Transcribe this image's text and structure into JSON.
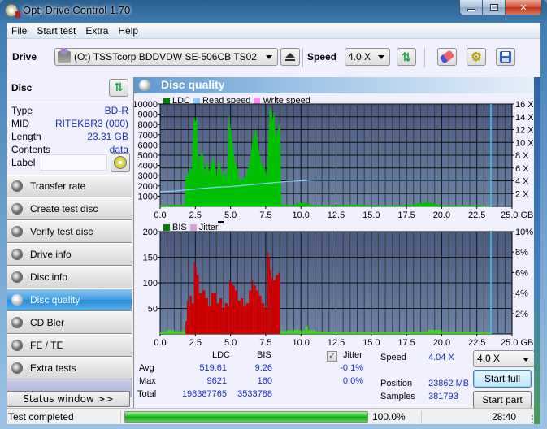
{
  "window": {
    "title": "Opti Drive Control 1.70",
    "controls": {
      "minimize": "minimize",
      "maximize": "maximize",
      "close": "close"
    }
  },
  "menu": [
    "File",
    "Start test",
    "Extra",
    "Help"
  ],
  "toolbar": {
    "drive_label": "Drive",
    "drive_value": "(O:)  TSSTcorp BDDVDW SE-506CB TS02",
    "speed_label": "Speed",
    "speed_value": "4.0 X",
    "icons": [
      "eject-icon",
      "refresh-icon",
      "erase-icon",
      "settings-icon",
      "save-icon"
    ]
  },
  "disc": {
    "title": "Disc",
    "fields": [
      {
        "label": "Type",
        "value": "BD-R"
      },
      {
        "label": "MID",
        "value": "RITEKBR3 (000)"
      },
      {
        "label": "Length",
        "value": "23.31 GB"
      },
      {
        "label": "Contents",
        "value": "data"
      }
    ],
    "label_field_label": "Label",
    "label_field_value": ""
  },
  "nav": {
    "items": [
      {
        "label": "Transfer rate",
        "active": false
      },
      {
        "label": "Create test disc",
        "active": false
      },
      {
        "label": "Verify test disc",
        "active": false
      },
      {
        "label": "Drive info",
        "active": false
      },
      {
        "label": "Disc info",
        "active": false
      },
      {
        "label": "Disc quality",
        "active": true
      },
      {
        "label": "CD Bler",
        "active": false
      },
      {
        "label": "FE / TE",
        "active": false
      },
      {
        "label": "Extra tests",
        "active": false
      }
    ],
    "status_window_label": "Status window >>"
  },
  "panel": {
    "title": "Disc quality"
  },
  "colors": {
    "ldc": "#00c000",
    "read_speed": "#87cefa",
    "write_speed": "#ff88ff",
    "bis": "#cc0000",
    "bis_legend": "#008000",
    "jitter": "#d8a0d8",
    "plot_bg_top": "#4a5a7e",
    "plot_bg_bottom": "#6e82a6",
    "marker": "#40c8f0"
  },
  "chart_data": [
    {
      "type": "area",
      "title": "LDC",
      "legend": [
        "LDC",
        "Read speed",
        "Write speed"
      ],
      "legend_placement": "top-left",
      "xlabel": "GB",
      "x_ticks": [
        "0.0",
        "2.5",
        "5.0",
        "7.5",
        "10.0",
        "12.5",
        "15.0",
        "17.5",
        "20.0",
        "22.5",
        "25.0 GB"
      ],
      "xlim": [
        0,
        25
      ],
      "y_ticks": [
        "1000",
        "2000",
        "3000",
        "4000",
        "5000",
        "6000",
        "7000",
        "8000",
        "9000",
        "10000"
      ],
      "ylim": [
        0,
        10000
      ],
      "y2_ticks": [
        "2 X",
        "4 X",
        "6 X",
        "8 X",
        "10 X",
        "12 X",
        "14 X",
        "16 X"
      ],
      "y2lim": [
        0,
        16
      ],
      "grid": true,
      "marker_x": 23.5,
      "series": [
        {
          "name": "LDC",
          "x": [
            0,
            0.5,
            1.0,
            1.5,
            1.75,
            1.8,
            2.0,
            2.1,
            2.25,
            2.4,
            2.5,
            2.6,
            2.7,
            2.8,
            3.0,
            3.2,
            3.3,
            3.5,
            3.75,
            4.0,
            4.2,
            4.4,
            4.5,
            4.75,
            4.9,
            5.0,
            5.1,
            5.3,
            5.5,
            5.6,
            5.8,
            6.0,
            6.2,
            6.4,
            6.6,
            6.8,
            7.0,
            7.2,
            7.4,
            7.6,
            7.8,
            7.9,
            8.0,
            8.1,
            8.2,
            8.4,
            8.5,
            8.6,
            9.0,
            9.5,
            10.0,
            10.3,
            10.5,
            11.0,
            12.0,
            13.0,
            14.0,
            15.0,
            17.5,
            19.0,
            20.0,
            22.5,
            23.5
          ],
          "values": [
            100,
            80,
            150,
            100,
            120,
            2800,
            3200,
            3900,
            2700,
            8700,
            8200,
            8700,
            3000,
            4700,
            5300,
            2900,
            4300,
            3300,
            4800,
            2800,
            4500,
            2500,
            3500,
            2600,
            9000,
            7500,
            6500,
            4300,
            3600,
            2500,
            2600,
            2800,
            3300,
            4500,
            6500,
            7500,
            5300,
            4100,
            3800,
            2600,
            9600,
            9400,
            8200,
            9200,
            6500,
            7500,
            8200,
            150,
            120,
            100,
            350,
            300,
            200,
            100,
            80,
            120,
            150,
            60,
            60,
            400,
            60,
            80,
            0
          ]
        },
        {
          "name": "Read speed",
          "unit": "X",
          "x": [
            0,
            1.0,
            2.0,
            3.0,
            4.0,
            5.0,
            6.0,
            7.0,
            8.0,
            9.0,
            10.0,
            11.0,
            12.0,
            13.0,
            23.5
          ],
          "values": [
            2.3,
            2.4,
            2.6,
            2.8,
            3.0,
            3.1,
            3.3,
            3.5,
            3.7,
            3.9,
            4.0,
            4.1,
            4.1,
            4.1,
            4.1
          ]
        },
        {
          "name": "Write speed",
          "x": [],
          "values": []
        }
      ]
    },
    {
      "type": "bar",
      "title": "BIS",
      "legend": [
        "BIS",
        "Jitter"
      ],
      "legend_placement": "top-left",
      "xlabel": "GB",
      "x_ticks": [
        "0.0",
        "2.5",
        "5.0",
        "7.5",
        "10.0",
        "12.5",
        "15.0",
        "17.5",
        "20.0",
        "22.5",
        "25.0 GB"
      ],
      "xlim": [
        0,
        25
      ],
      "y_ticks": [
        "50",
        "100",
        "150",
        "200"
      ],
      "ylim": [
        0,
        200
      ],
      "y2_ticks": [
        "2%",
        "4%",
        "6%",
        "8%",
        "10%"
      ],
      "y2lim": [
        0,
        10
      ],
      "grid": true,
      "marker_x": 23.5,
      "series": [
        {
          "name": "BIS",
          "x": [
            0,
            0.5,
            1.0,
            1.5,
            1.75,
            1.8,
            1.9,
            2.0,
            2.1,
            2.25,
            2.4,
            2.5,
            2.6,
            2.75,
            3.0,
            3.2,
            3.4,
            3.6,
            3.75,
            4.0,
            4.2,
            4.4,
            4.6,
            4.8,
            4.9,
            5.0,
            5.1,
            5.3,
            5.5,
            5.7,
            5.9,
            6.1,
            6.3,
            6.5,
            6.6,
            6.8,
            7.0,
            7.2,
            7.4,
            7.6,
            7.7,
            7.8,
            7.9,
            8.0,
            8.2,
            8.4,
            8.5,
            8.6,
            9.0,
            9.5,
            10.0,
            10.3,
            10.5,
            11.0,
            12.5,
            15.0,
            17.5,
            19.0,
            20.0,
            22.5,
            23.5
          ],
          "values": [
            5,
            8,
            5,
            6,
            10,
            25,
            65,
            55,
            75,
            60,
            140,
            130,
            115,
            80,
            85,
            70,
            55,
            80,
            80,
            60,
            70,
            50,
            60,
            55,
            105,
            100,
            95,
            85,
            65,
            70,
            55,
            60,
            85,
            105,
            95,
            85,
            75,
            60,
            50,
            160,
            150,
            125,
            110,
            105,
            115,
            120,
            5,
            6,
            7,
            8,
            6,
            15,
            8,
            5,
            4,
            4,
            5,
            8,
            5,
            4,
            0
          ]
        },
        {
          "name": "Jitter",
          "unit": "%",
          "x": [],
          "values": []
        }
      ]
    }
  ],
  "stats": {
    "col_ldc": "LDC",
    "col_bis": "BIS",
    "rows": [
      {
        "label": "Avg",
        "ldc": "519.61",
        "bis": "9.26"
      },
      {
        "label": "Max",
        "ldc": "9621",
        "bis": "160"
      },
      {
        "label": "Total",
        "ldc": "198387765",
        "bis": "3533788"
      }
    ],
    "jitter_label": "Jitter",
    "jitter_checked": true,
    "jitter_avg": "-0.1%",
    "jitter_max": "0.0%",
    "speed_label": "Speed",
    "speed_value": "4.04 X",
    "position_label": "Position",
    "position_value": "23862 MB",
    "samples_label": "Samples",
    "samples_value": "381793",
    "speed_select": "4.0 X",
    "start_full": "Start full",
    "start_part": "Start part"
  },
  "statusbar": {
    "text": "Test completed",
    "progress_percent": 100.0,
    "progress_text": "100.0%",
    "time": "28:40"
  }
}
